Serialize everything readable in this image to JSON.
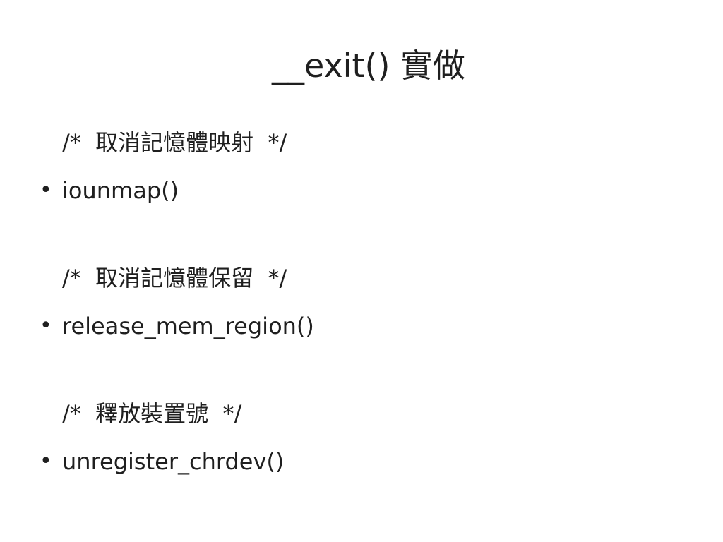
{
  "slide": {
    "title": "__exit() 實做",
    "sections": [
      {
        "comment": "/*  取消記憶體映射  */",
        "item": "iounmap()"
      },
      {
        "comment": "/*  取消記憶體保留  */",
        "item": "release_mem_region()"
      },
      {
        "comment": "/*  釋放裝置號  */",
        "item": "unregister_chrdev()"
      }
    ],
    "bullet_glyph": "•"
  }
}
